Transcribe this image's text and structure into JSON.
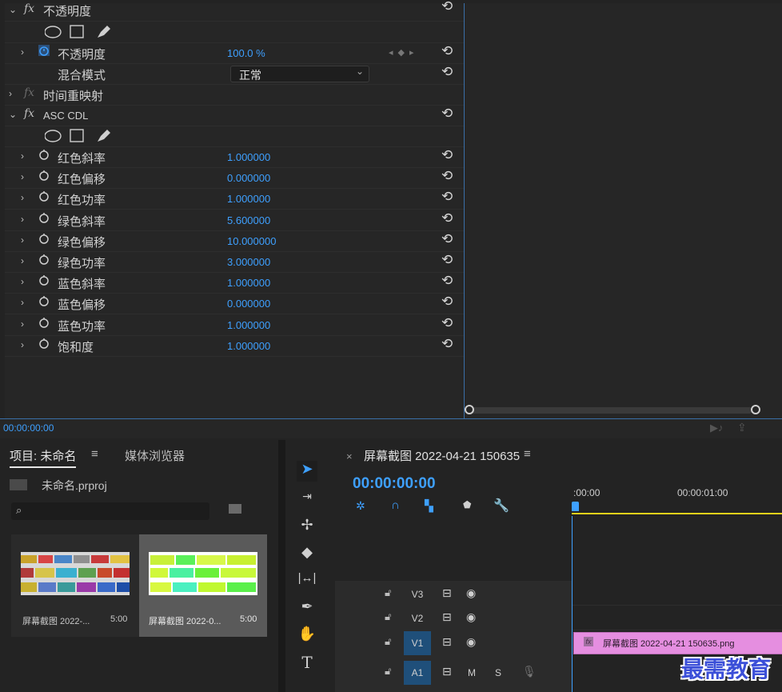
{
  "effects": {
    "opacity_section": "不透明度",
    "opacity_param": "不透明度",
    "opacity_value": "100.0 %",
    "blend_label": "混合模式",
    "blend_value": "正常",
    "time_remap": "时间重映射",
    "asc_cdl": "ASC CDL",
    "fx_symbol": "fx",
    "params": [
      {
        "label": "红色斜率",
        "value": "1.000000"
      },
      {
        "label": "红色偏移",
        "value": "0.000000"
      },
      {
        "label": "红色功率",
        "value": "1.000000"
      },
      {
        "label": "绿色斜率",
        "value": "5.600000"
      },
      {
        "label": "绿色偏移",
        "value": "10.000000"
      },
      {
        "label": "绿色功率",
        "value": "3.000000"
      },
      {
        "label": "蓝色斜率",
        "value": "1.000000"
      },
      {
        "label": "蓝色偏移",
        "value": "0.000000"
      },
      {
        "label": "蓝色功率",
        "value": "1.000000"
      },
      {
        "label": "饱和度",
        "value": "1.000000"
      }
    ],
    "timecode": "00:00:00:00"
  },
  "project": {
    "tab_project": "项目: 未命名",
    "tab_media": "媒体浏览器",
    "menu_icon": "≡",
    "file_name": "未命名.prproj",
    "items": [
      {
        "name": "屏幕截图 2022-...",
        "duration": "5:00"
      },
      {
        "name": "屏幕截图 2022-0...",
        "duration": "5:00"
      }
    ]
  },
  "timeline": {
    "close": "×",
    "sequence_title": "屏幕截图 2022-04-21 150635",
    "menu_icon": "≡",
    "timecode": "00:00:00:00",
    "ruler_start": ":00:00",
    "ruler_one": "00:00:01:00",
    "tracks": [
      {
        "name": "V3"
      },
      {
        "name": "V2"
      },
      {
        "name": "V1"
      },
      {
        "name": "A1",
        "m": "M",
        "s": "S"
      }
    ],
    "clip_fx": "fx",
    "clip_name": "屏幕截图 2022-04-21 150635.png"
  },
  "watermark": "最需教育",
  "colors": {
    "accent_blue": "#3ea0ff",
    "clip_pink": "#e58ee0",
    "playhead_yellow": "#e8d21a"
  }
}
